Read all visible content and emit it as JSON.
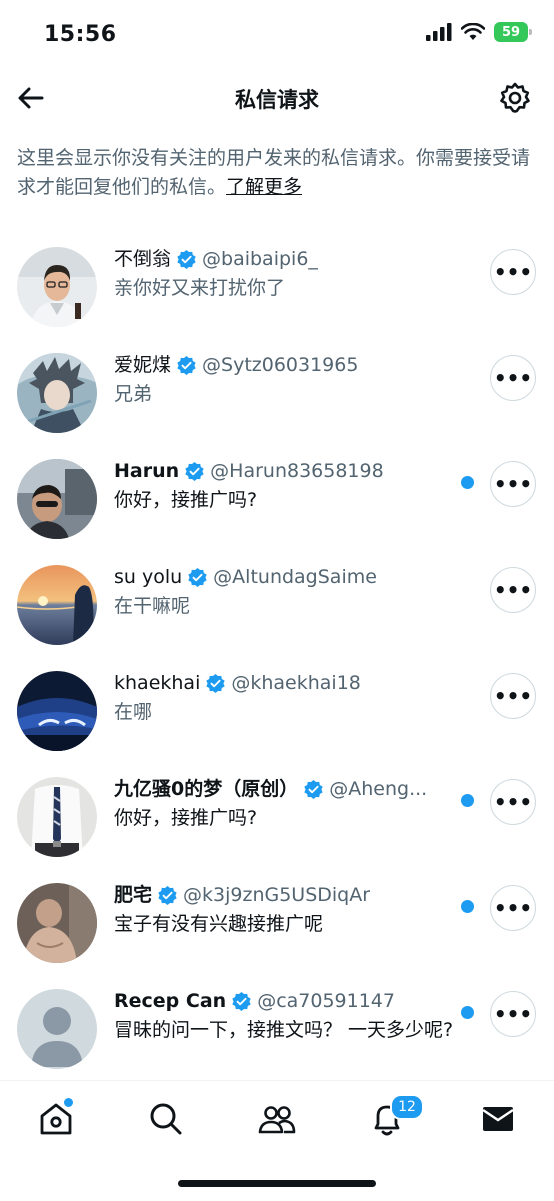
{
  "status_bar": {
    "time": "15:56",
    "battery": "59"
  },
  "header": {
    "title": "私信请求"
  },
  "intro": {
    "text": "这里会显示你没有关注的用户发来的私信请求。你需要接受请求才能回复他们的私信。",
    "link": "了解更多"
  },
  "requests": [
    {
      "name": "不倒翁",
      "handle": "@baibaipi6_",
      "message": "亲你好又来打扰你了",
      "unread": false
    },
    {
      "name": "爱妮煤",
      "handle": "@Sytz06031965",
      "message": "兄弟",
      "unread": false
    },
    {
      "name": "Harun",
      "handle": "@Harun83658198",
      "message": "你好，接推广吗?",
      "unread": true
    },
    {
      "name": "su yolu",
      "handle": "@AltundagSaime",
      "message": "在干嘛呢",
      "unread": false
    },
    {
      "name": "khaekhai",
      "handle": "@khaekhai18",
      "message": "在哪",
      "unread": false
    },
    {
      "name": "九亿骚0的梦（原创）",
      "handle": "@Aheng...",
      "message": "你好，接推广吗?",
      "unread": true
    },
    {
      "name": "肥宅",
      "handle": "@k3j9znG5USDiqAr",
      "message": "宝子有没有兴趣接推广呢",
      "unread": true
    },
    {
      "name": "Recep Can",
      "handle": "@ca70591147",
      "message": "冒昧的问一下，接推文吗？ 一天多少呢?",
      "unread": true
    }
  ],
  "more_label": "•••",
  "tabbar": {
    "notifications_badge": "12"
  },
  "colors": {
    "accent": "#1d9bf0",
    "verified": "#1d9bf0",
    "secondary_text": "#536471"
  }
}
